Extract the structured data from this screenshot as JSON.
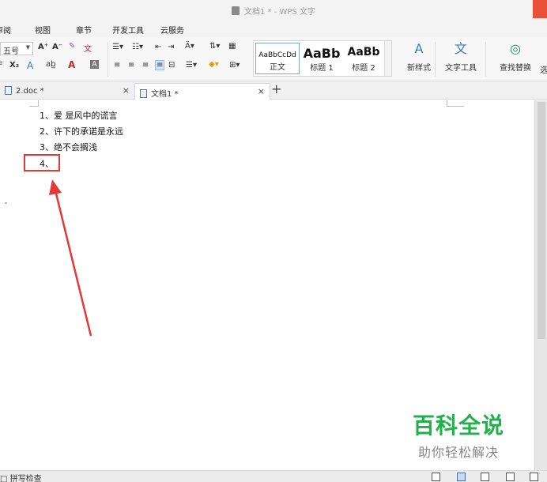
{
  "window": {
    "title": "文档1 * - WPS 文字",
    "icon": "wps-doc-icon"
  },
  "menu": {
    "items": [
      "审阅",
      "视图",
      "章节",
      "开发工具",
      "云服务"
    ]
  },
  "toolbar": {
    "font_size": "五号",
    "grow_font": "A⁺",
    "shrink_font": "A⁻",
    "subscript": "X₂",
    "styles": [
      {
        "preview": "AaBbCcDd",
        "name": "正文"
      },
      {
        "preview": "AaBb",
        "name": "标题 1"
      },
      {
        "preview": "AaBb",
        "name": "标题 2"
      }
    ],
    "new_style": "新样式",
    "text_tools": "文字工具",
    "find_replace": "查找替换",
    "select": "选"
  },
  "tabs": [
    {
      "label": "2.doc *",
      "active": false
    },
    {
      "label": "文档1 *",
      "active": true
    }
  ],
  "document": {
    "lines": [
      "1、爱 是风中的谎言",
      "2、许下的承诺是永远",
      "3、绝不会搁浅",
      "4、"
    ]
  },
  "watermark": {
    "main": "百科全说",
    "sub": "助你轻松解决"
  },
  "statusbar": {
    "spell_check": "□ 拼写检查"
  },
  "colors": {
    "highlight": "#e53935",
    "watermark_green": "#22b04b",
    "close_red": "#e8503a"
  }
}
